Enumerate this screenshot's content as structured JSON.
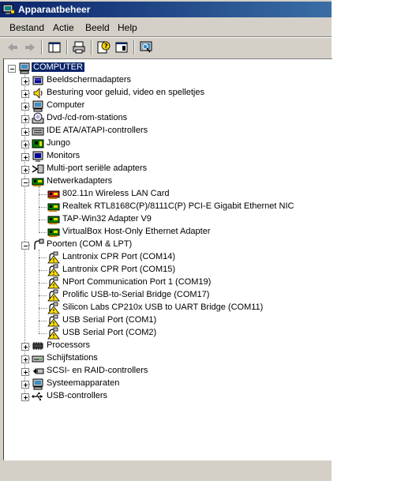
{
  "window": {
    "title": "Apparaatbeheer"
  },
  "menu": [
    "Bestand",
    "Actie",
    "Beeld",
    "Help"
  ],
  "toolbar": [
    {
      "name": "back-arrow-icon",
      "enabled": false
    },
    {
      "name": "forward-arrow-icon",
      "enabled": false
    },
    {
      "name": "show-hide-console-tree-icon",
      "enabled": true
    },
    {
      "name": "print-icon",
      "enabled": true
    },
    {
      "name": "help-icon",
      "enabled": true
    },
    {
      "name": "properties-icon",
      "enabled": true
    },
    {
      "name": "scan-hardware-icon",
      "enabled": true
    }
  ],
  "tree": {
    "root": "COMPUTER",
    "items": [
      {
        "label": "Beeldschermadapters",
        "icon": "display-adapter-icon",
        "expanded": false
      },
      {
        "label": "Besturing voor geluid, video en spelletjes",
        "icon": "sound-icon",
        "expanded": false
      },
      {
        "label": "Computer",
        "icon": "computer-icon",
        "expanded": false
      },
      {
        "label": "Dvd-/cd-rom-stations",
        "icon": "cdrom-icon",
        "expanded": false
      },
      {
        "label": "IDE ATA/ATAPI-controllers",
        "icon": "ide-controller-icon",
        "expanded": false
      },
      {
        "label": "Jungo",
        "icon": "board-icon",
        "expanded": false
      },
      {
        "label": "Monitors",
        "icon": "monitor-icon",
        "expanded": false
      },
      {
        "label": "Multi-port seriële adapters",
        "icon": "multiport-icon",
        "expanded": false
      },
      {
        "label": "Netwerkadapters",
        "icon": "network-adapter-icon",
        "expanded": true,
        "children": [
          {
            "label": "802.11n Wireless LAN Card",
            "icon": "network-card-disabled-icon"
          },
          {
            "label": "Realtek RTL8168C(P)/8111C(P) PCI-E Gigabit Ethernet NIC",
            "icon": "network-card-icon"
          },
          {
            "label": "TAP-Win32 Adapter V9",
            "icon": "network-card-icon"
          },
          {
            "label": "VirtualBox Host-Only Ethernet Adapter",
            "icon": "network-card-icon"
          }
        ]
      },
      {
        "label": "Poorten (COM & LPT)",
        "icon": "port-icon",
        "expanded": true,
        "children": [
          {
            "label": "Lantronix CPR Port (COM14)",
            "icon": "port-warning-icon"
          },
          {
            "label": "Lantronix CPR Port (COM15)",
            "icon": "port-warning-icon"
          },
          {
            "label": "NPort Communication Port 1 (COM19)",
            "icon": "port-warning-icon"
          },
          {
            "label": "Prolific USB-to-Serial Bridge (COM17)",
            "icon": "port-warning-icon"
          },
          {
            "label": "Silicon Labs CP210x USB to UART Bridge (COM11)",
            "icon": "port-warning-icon"
          },
          {
            "label": "USB Serial Port (COM1)",
            "icon": "port-warning-icon"
          },
          {
            "label": "USB Serial Port (COM2)",
            "icon": "port-warning-icon"
          }
        ]
      },
      {
        "label": "Processors",
        "icon": "processor-icon",
        "expanded": false
      },
      {
        "label": "Schijfstations",
        "icon": "disk-drive-icon",
        "expanded": false
      },
      {
        "label": "SCSI- en RAID-controllers",
        "icon": "scsi-icon",
        "expanded": false
      },
      {
        "label": "Systeemapparaten",
        "icon": "system-device-icon",
        "expanded": false
      },
      {
        "label": "USB-controllers",
        "icon": "usb-icon",
        "expanded": false
      }
    ]
  }
}
